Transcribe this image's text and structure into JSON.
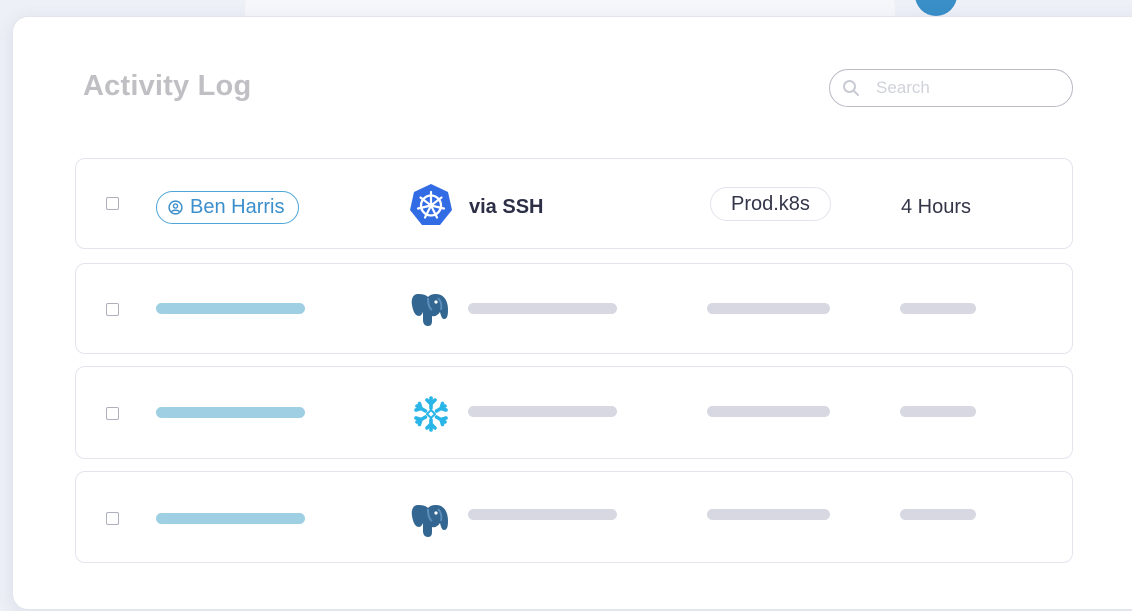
{
  "activity_log": {
    "title": "Activity Log",
    "search": {
      "placeholder": "Search",
      "value": ""
    },
    "rows": [
      {
        "user": "Ben Harris",
        "service_icon": "kubernetes-icon",
        "connection": "via SSH",
        "resource": "Prod.k8s",
        "time": "4 Hours",
        "loaded": true
      },
      {
        "service_icon": "postgresql-icon",
        "loaded": false
      },
      {
        "service_icon": "snowflake-icon",
        "loaded": false
      },
      {
        "service_icon": "postgresql-icon",
        "loaded": false
      }
    ]
  },
  "colors": {
    "accent_blue": "#3c8fcc",
    "kubernetes_blue": "#326ce5",
    "postgres_blue": "#336791",
    "snowflake_blue": "#29b5e8",
    "placeholder_bar_user": "#9fcfe2",
    "placeholder_bar_gray": "#d7d8e1"
  }
}
